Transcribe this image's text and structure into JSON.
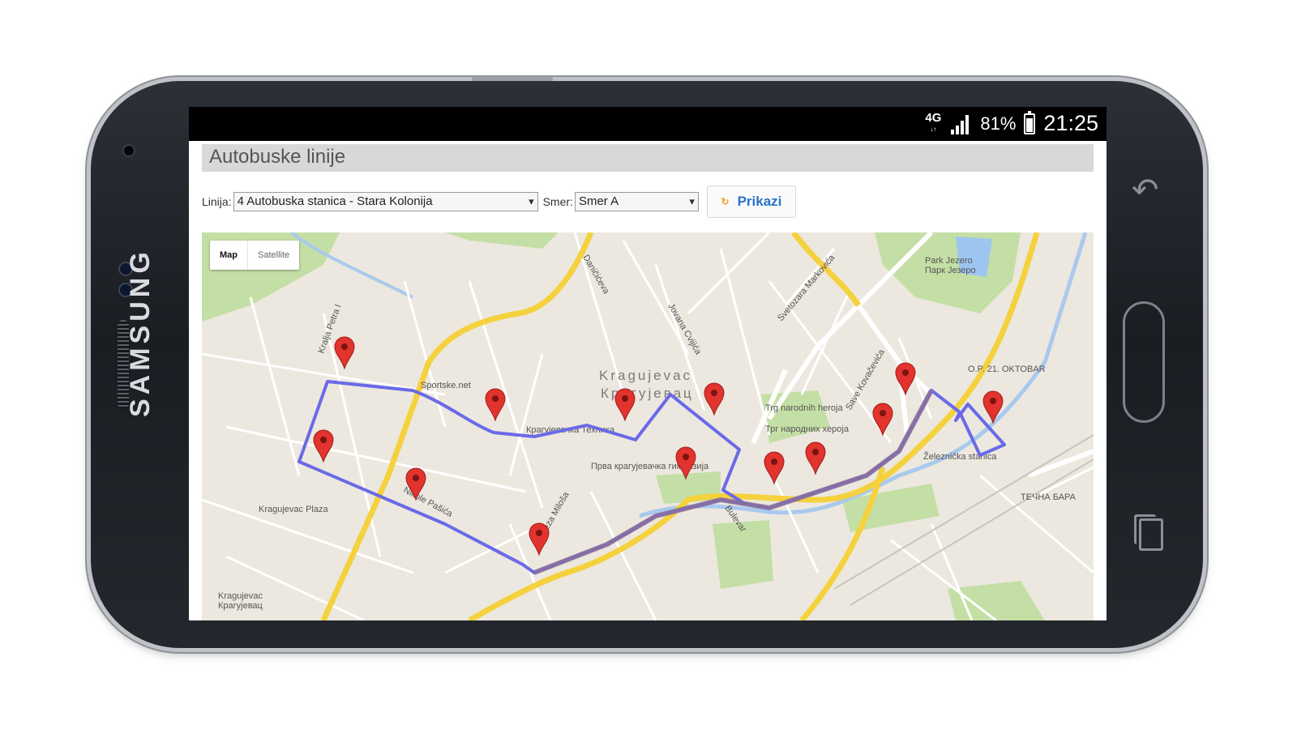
{
  "device": {
    "brand": "SAMSUNG"
  },
  "statusbar": {
    "network": "4G",
    "network_sub": "↓↑",
    "battery": "81%",
    "time": "21:25"
  },
  "page": {
    "title": "Autobuske linije"
  },
  "controls": {
    "line_label": "Linija:",
    "line_value": "4 Autobuska stanica - Stara Kolonija",
    "direction_label": "Smer:",
    "direction_value": "Smer A",
    "show_button": "Prikazi"
  },
  "map": {
    "type_map": "Map",
    "type_satellite": "Satellite",
    "city_label": "Kragujevac",
    "city_label_cyr": "Крагујевац",
    "places": {
      "sports": "Sportske.net",
      "plaza": "Kragujevac Plaza",
      "park": "Park Jezero",
      "park_cyr": "Парк Језеро",
      "gymnasium": "Прва крагујевачка гимназија",
      "square": "Trg narodnih heroja",
      "square_cyr": "Трг народних хероја",
      "oktobar": "O.P. 21. OKTOBAR",
      "railway": "Železnička stanica",
      "tecna_bara": "ТЕЧНА БАРА",
      "hotel": "Kragujevac",
      "hotel_cyr": "Крагујевац",
      "school": "Крагујевачка Техника"
    },
    "roads": [
      "Nikole Pašića",
      "Kralja Petra I",
      "Daničićeva",
      "Svetozara Markovića",
      "Save Kovačevića",
      "Bulevar",
      "Jovana Cvijića",
      "Kneza Miloša"
    ],
    "route_markers": 14,
    "colors": {
      "route": "#6a6ae8",
      "route_overlap": "#8a6f9a",
      "marker": "#e2332e",
      "highway": "#f5d13d",
      "park": "#c4dfa5",
      "water": "#9ec4f0",
      "land": "#ece8df"
    }
  }
}
